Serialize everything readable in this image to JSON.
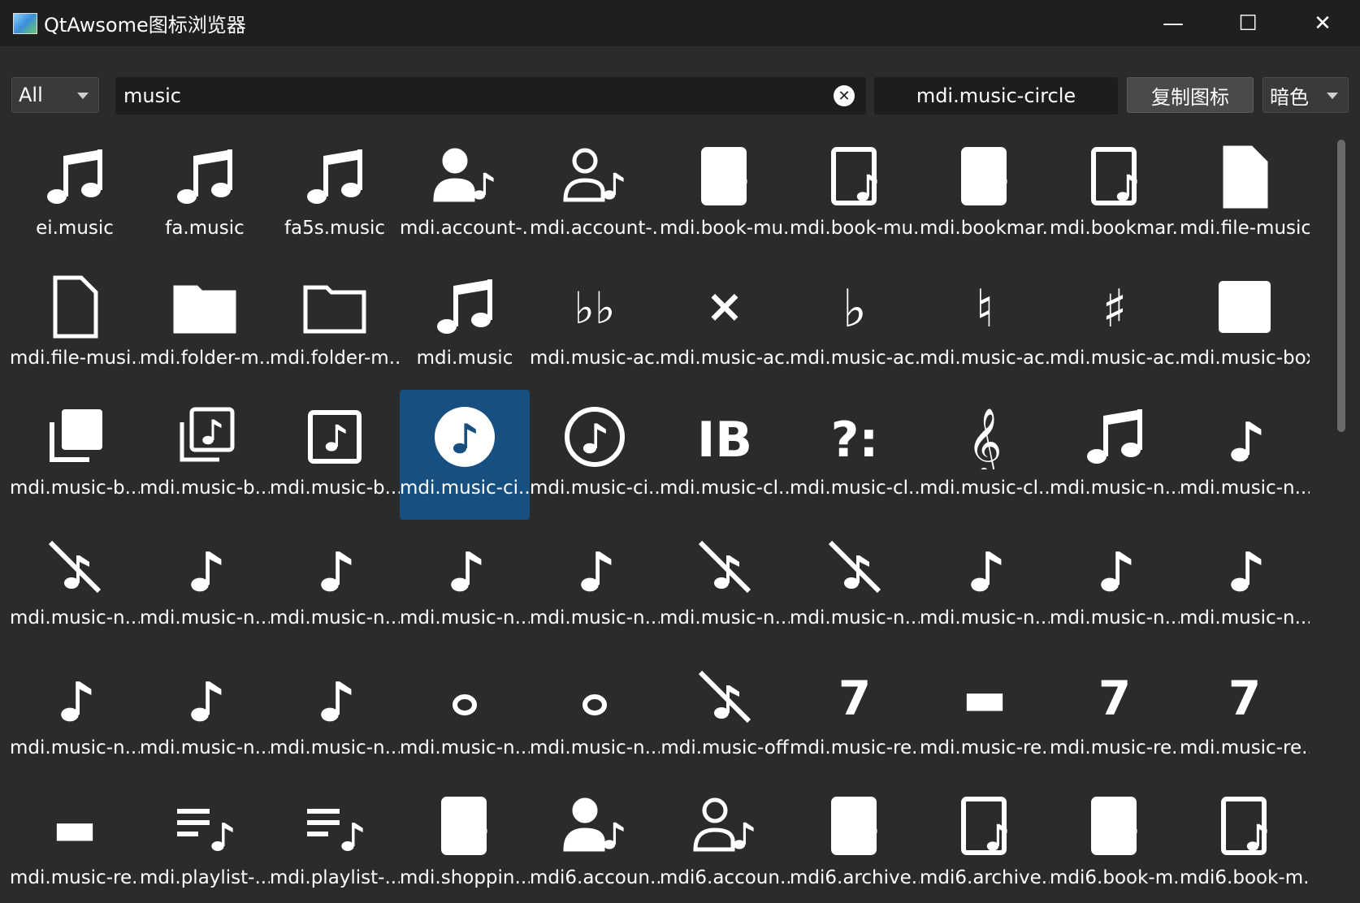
{
  "window": {
    "title": "QtAwsome图标浏览器"
  },
  "toolbar": {
    "filter_value": "All",
    "search_value": "music",
    "selected_name": "mdi.music-circle",
    "copy_label": "复制图标",
    "theme_value": "暗色"
  },
  "icons": [
    {
      "label": "ei.music",
      "icon": "music-note-icon"
    },
    {
      "label": "fa.music",
      "icon": "music-note-icon"
    },
    {
      "label": "fa5s.music",
      "icon": "music-note-icon"
    },
    {
      "label": "mdi.account-...",
      "icon": "account-music-icon"
    },
    {
      "label": "mdi.account-...",
      "icon": "account-music-outline-icon"
    },
    {
      "label": "mdi.book-mu...",
      "icon": "book-music-icon"
    },
    {
      "label": "mdi.book-mu...",
      "icon": "book-music-outline-icon"
    },
    {
      "label": "mdi.bookmar...",
      "icon": "bookmark-music-icon"
    },
    {
      "label": "mdi.bookmar...",
      "icon": "bookmark-music-outline-icon"
    },
    {
      "label": "mdi.file-music",
      "icon": "file-music-icon"
    },
    {
      "label": "mdi.file-musi...",
      "icon": "file-music-outline-icon"
    },
    {
      "label": "mdi.folder-m...",
      "icon": "folder-music-icon"
    },
    {
      "label": "mdi.folder-m...",
      "icon": "folder-music-outline-icon"
    },
    {
      "label": "mdi.music",
      "icon": "music-note-icon"
    },
    {
      "label": "mdi.music-ac...",
      "icon": "music-accidental-double-flat-icon"
    },
    {
      "label": "mdi.music-ac...",
      "icon": "music-accidental-double-sharp-icon"
    },
    {
      "label": "mdi.music-ac...",
      "icon": "music-accidental-flat-icon"
    },
    {
      "label": "mdi.music-ac...",
      "icon": "music-accidental-natural-icon"
    },
    {
      "label": "mdi.music-ac...",
      "icon": "music-accidental-sharp-icon"
    },
    {
      "label": "mdi.music-box",
      "icon": "music-box-icon"
    },
    {
      "label": "mdi.music-b...",
      "icon": "music-box-multiple-icon"
    },
    {
      "label": "mdi.music-b...",
      "icon": "music-box-multiple-outline-icon"
    },
    {
      "label": "mdi.music-b...",
      "icon": "music-box-outline-icon"
    },
    {
      "label": "mdi.music-ci...",
      "icon": "music-circle-icon",
      "selected": true
    },
    {
      "label": "mdi.music-ci...",
      "icon": "music-circle-outline-icon"
    },
    {
      "label": "mdi.music-cl...",
      "icon": "music-clef-alto-icon"
    },
    {
      "label": "mdi.music-cl...",
      "icon": "music-clef-bass-icon"
    },
    {
      "label": "mdi.music-cl...",
      "icon": "music-clef-treble-icon"
    },
    {
      "label": "mdi.music-n...",
      "icon": "music-note-icon"
    },
    {
      "label": "mdi.music-n...",
      "icon": "music-note-bluetooth-icon"
    },
    {
      "label": "mdi.music-n...",
      "icon": "music-note-bluetooth-off-icon"
    },
    {
      "label": "mdi.music-n...",
      "icon": "music-note-eighth-icon"
    },
    {
      "label": "mdi.music-n...",
      "icon": "music-note-eighth-dotted-icon"
    },
    {
      "label": "mdi.music-n...",
      "icon": "music-note-half-icon"
    },
    {
      "label": "mdi.music-n...",
      "icon": "music-note-half-dotted-icon"
    },
    {
      "label": "mdi.music-n...",
      "icon": "music-note-off-icon"
    },
    {
      "label": "mdi.music-n...",
      "icon": "music-note-off-outline-icon"
    },
    {
      "label": "mdi.music-n...",
      "icon": "music-note-outline-icon"
    },
    {
      "label": "mdi.music-n...",
      "icon": "music-note-plus-icon"
    },
    {
      "label": "mdi.music-n...",
      "icon": "music-note-quarter-icon"
    },
    {
      "label": "mdi.music-n...",
      "icon": "music-note-quarter-dotted-icon"
    },
    {
      "label": "mdi.music-n...",
      "icon": "music-note-sixteenth-icon"
    },
    {
      "label": "mdi.music-n...",
      "icon": "music-note-sixteenth-dotted-icon"
    },
    {
      "label": "mdi.music-n...",
      "icon": "music-note-whole-icon"
    },
    {
      "label": "mdi.music-n...",
      "icon": "music-note-whole-dotted-icon"
    },
    {
      "label": "mdi.music-off",
      "icon": "music-off-icon"
    },
    {
      "label": "mdi.music-re...",
      "icon": "music-rest-eighth-icon"
    },
    {
      "label": "mdi.music-re...",
      "icon": "music-rest-half-icon"
    },
    {
      "label": "mdi.music-re...",
      "icon": "music-rest-quarter-icon"
    },
    {
      "label": "mdi.music-re...",
      "icon": "music-rest-sixteenth-icon"
    },
    {
      "label": "mdi.music-re...",
      "icon": "music-rest-whole-icon"
    },
    {
      "label": "mdi.playlist-...",
      "icon": "playlist-music-icon"
    },
    {
      "label": "mdi.playlist-...",
      "icon": "playlist-music-outline-icon"
    },
    {
      "label": "mdi.shoppin...",
      "icon": "shopping-music-icon"
    },
    {
      "label": "mdi6.accoun...",
      "icon": "account-music-icon"
    },
    {
      "label": "mdi6.accoun...",
      "icon": "account-music-outline-icon"
    },
    {
      "label": "mdi6.archive...",
      "icon": "archive-music-icon"
    },
    {
      "label": "mdi6.archive...",
      "icon": "archive-music-outline-icon"
    },
    {
      "label": "mdi6.book-m...",
      "icon": "book-music-icon"
    },
    {
      "label": "mdi6.book-m...",
      "icon": "book-music-outline-icon"
    }
  ],
  "colors": {
    "background": "#2b2b2b",
    "titlebar": "#1f1f1f",
    "selection": "#175080"
  }
}
